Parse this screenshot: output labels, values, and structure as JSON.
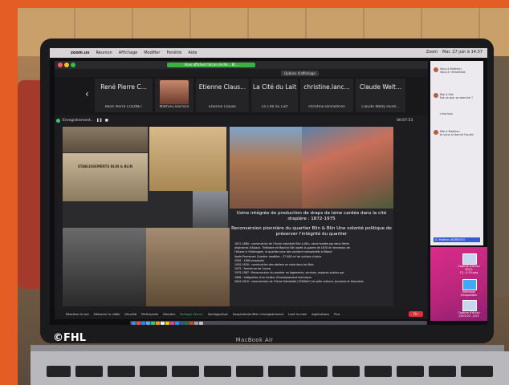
{
  "menubar": {
    "app": "zoom.us",
    "items": [
      "Réunion",
      "Affichage",
      "Modifier",
      "Fenêtre",
      "Aide"
    ],
    "right": [
      "Zoom",
      "Mar. 27 juin à 14:37"
    ]
  },
  "zoom": {
    "banner": "Vous affichez l'écran de Ré... Bl...",
    "view_options": "Options d'affichage",
    "participants": [
      {
        "display": "René Pierre C...",
        "name": "René Pierre COLINET"
      },
      {
        "display": "",
        "name": "Mathieu Barroso"
      },
      {
        "display": "Etienne Claus...",
        "name": "Etienne Clause"
      },
      {
        "display": "La Cité du Lait",
        "name": "La Cité du Lait"
      },
      {
        "display": "christine.lanc...",
        "name": "christine.lancastrien"
      },
      {
        "display": "Claude Welt...",
        "name": "Claude Welty Hurel..."
      }
    ],
    "share_label": "Enregistrement...",
    "timer": "00:07:53",
    "toolbar": [
      "Réactiver le son",
      "Démarrer la vidéo",
      "Sécurité",
      "Participants",
      "Discuter",
      "Partager l'écran",
      "Sondage/Quiz",
      "Suspendre/arrêter l'enregistrement",
      "Levé la main",
      "Applications",
      "Plus"
    ],
    "leave": "Fin"
  },
  "slide": {
    "title": "Usine intégrée de production de draps de laine cardée dans la cité drapière : 1872-1975",
    "subtitle": "Reconversion pionnière du quartier Blin & Blin Une volonté politique de préserver l'intégrité du quartier",
    "sign": "ETABLISSEMENTS BLIN & BLIN",
    "lines": [
      "1872-1880 : construction de l'Usine industriel Blin & Blin, usine fondée par deux frères",
      "originaires d'Alsace. Théodore et Maurice Blin après la guerre de 1870 et l'annexion de",
      "l'Alsace à l'Allemagne, le quartier pour des ouvriers transplantés à Elbeuf.",
      "Vaste Promenoir Quartier modèles : 27 000 m² de surface d'usine",
      "1920 : 1000 employés",
      "1920-1950 : construction des ateliers en shed dans les Bois",
      "1975 : fermeture de l'usine",
      "1979-1987 : Reconversion du quartier en logements, services, espaces publics par",
      "1988 : Intégration d'un institut d'enseignement technique",
      "2004-2010 : reconversion de l'Usine Gambetta (25000m²) en pôle culturel, jeunesse et éducation"
    ]
  },
  "chat": {
    "entries": [
      {
        "name": "Vous à Mathieu",
        "text": "Vous à l'ensemble"
      },
      {
        "name": "Moi à Elle",
        "text": "Est-ce que ça marche ?"
      },
      {
        "name": "",
        "text": "c'est bon"
      },
      {
        "name": "Moi à Mathieu",
        "text": "Je vous ai donné l'accès"
      }
    ],
    "to": "À: Mathieu BARROSO"
  },
  "desktop": {
    "icons": [
      "Capture d'écran 2023-12...9.53.png",
      "Éléments d'exposition",
      "Capture d'écran 2023-05...3.03"
    ]
  },
  "laptop": {
    "brand": "MacBook Air"
  },
  "watermark": "©FHL",
  "colors": {
    "frame": "#e35d24",
    "leave": "#e0303a",
    "banner": "#3bb143",
    "desktop": "#c7287f"
  }
}
